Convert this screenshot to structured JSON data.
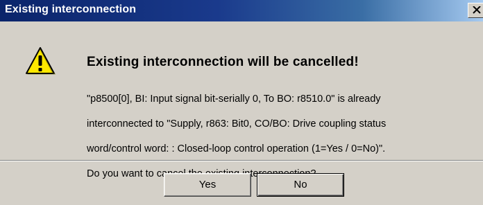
{
  "window": {
    "title": "Existing interconnection"
  },
  "dialog": {
    "icon": "warning-icon",
    "heading": "Existing interconnection will be cancelled!",
    "message_lines": [
      "\"p8500[0], BI: Input signal bit-serially 0, To BO: r8510.0\" is already",
      "interconnected to \"Supply, r863: Bit0, CO/BO: Drive coupling status",
      "word/control word: : Closed-loop control operation (1=Yes / 0=No)\".",
      "Do you want to cancel the existing interconnection?"
    ]
  },
  "buttons": {
    "yes_label": "Yes",
    "no_label": "No"
  },
  "colors": {
    "titlebar_start": "#0a246a",
    "titlebar_end": "#a6caf0",
    "face": "#d4d0c8",
    "warning_yellow": "#ffe800"
  }
}
